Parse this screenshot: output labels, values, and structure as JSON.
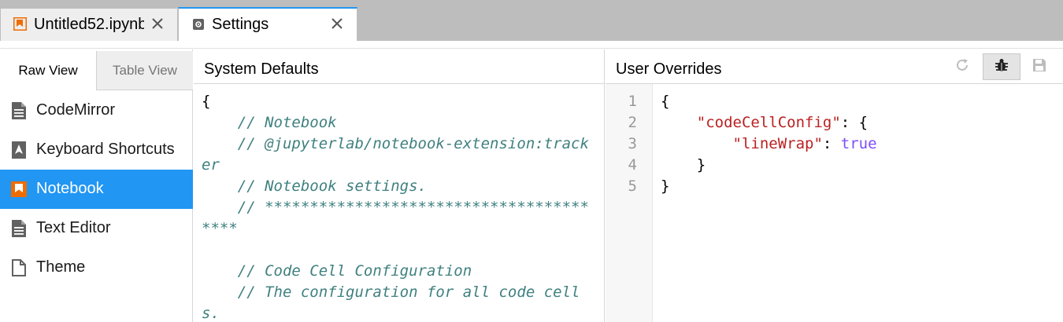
{
  "tabs": [
    {
      "label": "Untitled52.ipynb",
      "icon": "notebook-icon",
      "active": false
    },
    {
      "label": "Settings",
      "icon": "gear-icon",
      "active": true
    }
  ],
  "view_tabs": {
    "raw": "Raw View",
    "table": "Table View"
  },
  "plugins": [
    {
      "label": "CodeMirror",
      "icon": "text-file-icon"
    },
    {
      "label": "Keyboard Shortcuts",
      "icon": "keyboard-shortcut-icon"
    },
    {
      "label": "Notebook",
      "icon": "notebook-icon",
      "active": true
    },
    {
      "label": "Text Editor",
      "icon": "text-file-icon"
    },
    {
      "label": "Theme",
      "icon": "file-icon"
    }
  ],
  "system_defaults": {
    "title": "System Defaults",
    "lines": [
      {
        "text": "{",
        "type": "punct"
      },
      {
        "text": "    // Notebook",
        "type": "comment"
      },
      {
        "text": "    // @jupyterlab/notebook-extension:tracker",
        "type": "comment"
      },
      {
        "text": "    // Notebook settings.",
        "type": "comment"
      },
      {
        "text": "    // ****************************************",
        "type": "comment"
      },
      {
        "text": "",
        "type": "punct"
      },
      {
        "text": "    // Code Cell Configuration",
        "type": "comment"
      },
      {
        "text": "    // The configuration for all code cells.",
        "type": "comment"
      }
    ]
  },
  "user_overrides": {
    "title": "User Overrides",
    "line_numbers": [
      "1",
      "2",
      "3",
      "4",
      "5"
    ],
    "line1": "{",
    "line2_key": "\"codeCellConfig\"",
    "line2_rest": ": {",
    "line3_key": "\"lineWrap\"",
    "line3_sep": ": ",
    "line3_val": "true",
    "line4": "}",
    "line5": "}"
  },
  "colors": {
    "accent": "#2196f3",
    "comment": "#408080",
    "string": "#ba2121",
    "keyword": "#7c4dff"
  }
}
